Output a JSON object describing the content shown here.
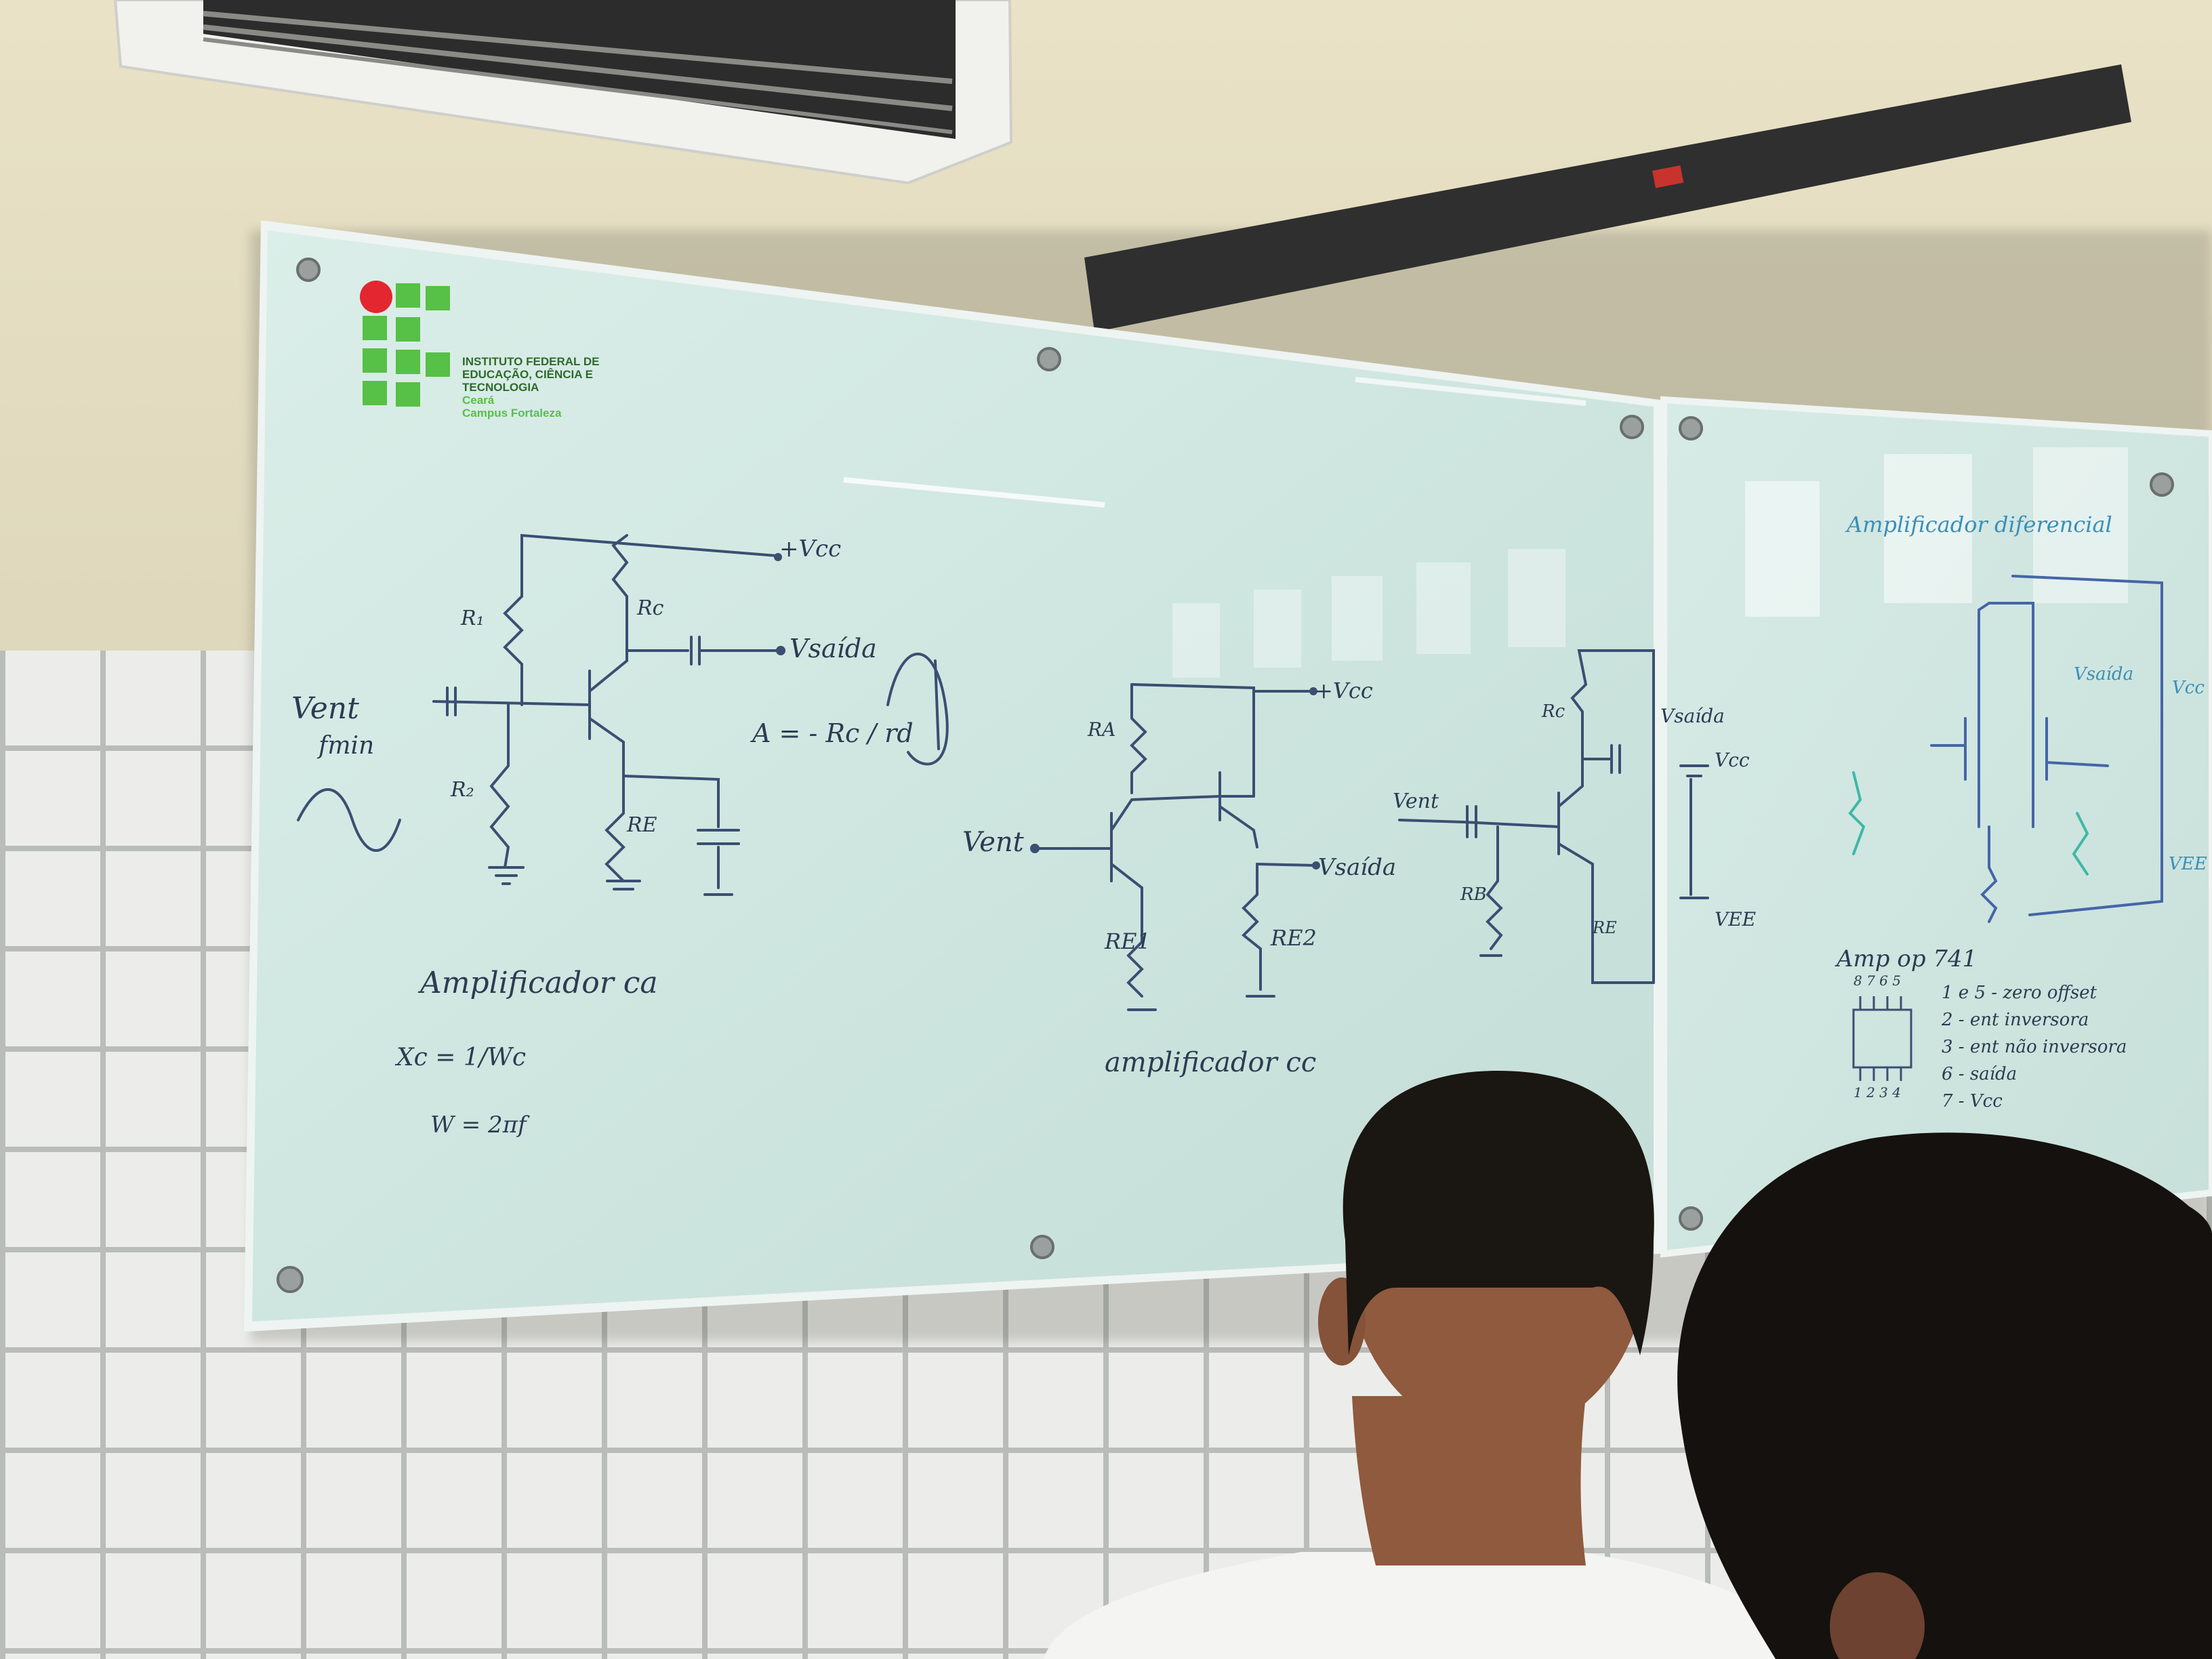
{
  "logo": {
    "line1": "INSTITUTO FEDERAL DE",
    "line2": "EDUCAÇÃO, CIÊNCIA E",
    "line3": "TECNOLOGIA",
    "line4": "Ceará",
    "line5": "Campus Fortaleza"
  },
  "board": {
    "circuit1": {
      "vcc": "+Vcc",
      "ra": "R₁",
      "rb": "R₂",
      "rc": "Rc",
      "re": "RE",
      "vin1": "Vent",
      "vin2": "fmin",
      "vout": "Vsaída",
      "gain": "A = - Rc / rd",
      "title": "Amplificador ca",
      "formula1": "Xc = 1/Wc",
      "formula2": "W = 2πf"
    },
    "circuit2": {
      "vcc": "+Vcc",
      "ra": "RA",
      "vin": "Vent",
      "vout": "Vsaída",
      "re1": "RE1",
      "re2": "RE2",
      "title": "amplificador cc"
    },
    "circuit3": {
      "vin": "Vent",
      "rc": "Rc",
      "rb": "RB",
      "re": "RE",
      "vout": "Vsaída",
      "vcc": "Vcc",
      "vee": "VEE"
    },
    "circuit4": {
      "title": "Amplificador diferencial",
      "vout": "Vsaída",
      "vcc": "Vcc",
      "vee": "VEE"
    },
    "opamp": {
      "title": "Amp op 741",
      "pins_top": "8 7 6 5",
      "pins_bottom": "1 2 3 4",
      "n1": "1 e 5 - zero offset",
      "n2": "2 - ent inversora",
      "n3": "3 - ent não inversora",
      "n4": "6 - saída",
      "n5": "7 - Vcc"
    }
  },
  "colors": {
    "board": "#cfe6e0",
    "ink": "#2b3c52",
    "ink_teal": "#3a8fb8",
    "logo_green": "#57c046",
    "logo_red": "#e3262f"
  }
}
